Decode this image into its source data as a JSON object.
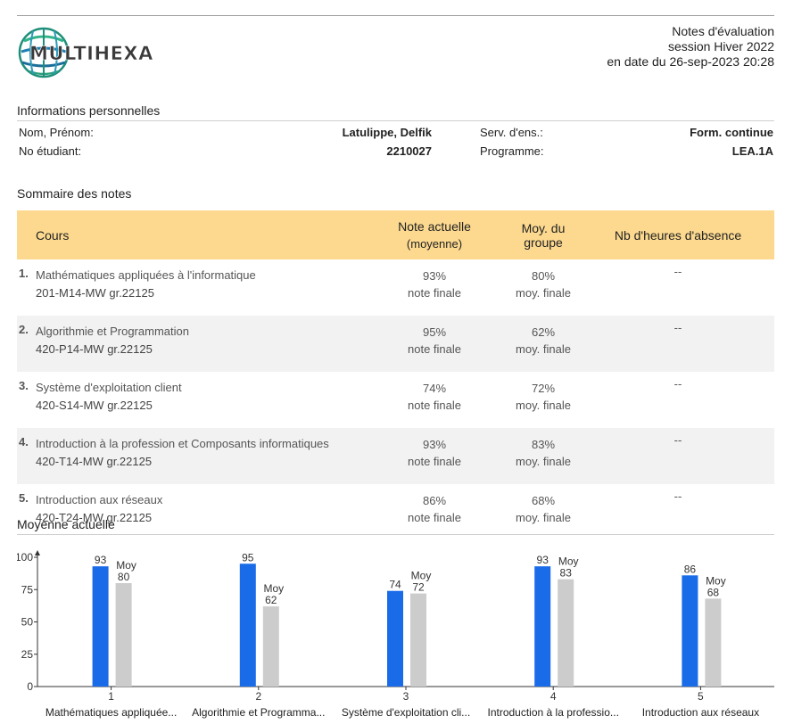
{
  "header": {
    "brand": "MULTIHEXA",
    "title": "Notes d'évaluation",
    "session": "session Hiver 2022",
    "date": "en date du 26-sep-2023 20:28"
  },
  "personal": {
    "section_title": "Informations personnelles",
    "name_label": "Nom, Prénom:",
    "name_value": "Latulippe, Delfik",
    "id_label": "No étudiant:",
    "id_value": "2210027",
    "service_label": "Serv. d'ens.:",
    "service_value": "Form. continue",
    "program_label": "Programme:",
    "program_value": "LEA.1A"
  },
  "summary": {
    "section_title": "Sommaire des notes",
    "columns": {
      "course": "Cours",
      "current_line1": "Note actuelle",
      "current_line2": "(moyenne)",
      "group": "Moy. du groupe",
      "absence": "Nb d'heures d'absence"
    },
    "rows": [
      {
        "num": "1.",
        "title": "Mathématiques appliquées à l'informatique",
        "code": "201-M14-MW gr.22125",
        "grade": "93%",
        "grade_note": "note finale",
        "avg": "80%",
        "avg_note": "moy. finale",
        "absence": "--"
      },
      {
        "num": "2.",
        "title": "Algorithmie et Programmation",
        "code": "420-P14-MW gr.22125",
        "grade": "95%",
        "grade_note": "note finale",
        "avg": "62%",
        "avg_note": "moy. finale",
        "absence": "--"
      },
      {
        "num": "3.",
        "title": "Système d'exploitation client",
        "code": "420-S14-MW gr.22125",
        "grade": "74%",
        "grade_note": "note finale",
        "avg": "72%",
        "avg_note": "moy. finale",
        "absence": "--"
      },
      {
        "num": "4.",
        "title": "Introduction à la profession et Composants informatiques",
        "code": "420-T14-MW gr.22125",
        "grade": "93%",
        "grade_note": "note finale",
        "avg": "83%",
        "avg_note": "moy. finale",
        "absence": "--"
      },
      {
        "num": "5.",
        "title": "Introduction aux réseaux",
        "code": "420-T24-MW gr.22125",
        "grade": "86%",
        "grade_note": "note finale",
        "avg": "68%",
        "avg_note": "moy. finale",
        "absence": "--"
      }
    ]
  },
  "chart_section_title": "Moyenne actuelle",
  "chart_data": {
    "type": "bar",
    "categories": [
      "1",
      "2",
      "3",
      "4",
      "5"
    ],
    "category_labels": [
      "Mathématiques appliquée...",
      "Algorithmie et Programma...",
      "Système d'exploitation cli...",
      "Introduction à la professio...",
      "Introduction aux réseaux"
    ],
    "series": [
      {
        "values": [
          93,
          95,
          74,
          93,
          86
        ],
        "color": "#1a6be8"
      },
      {
        "name": "Moy",
        "values": [
          80,
          62,
          72,
          83,
          68
        ],
        "color": "#cccccc"
      }
    ],
    "ylim": [
      0,
      100
    ],
    "yticks": [
      0,
      25,
      50,
      75,
      100
    ],
    "grid": false
  }
}
